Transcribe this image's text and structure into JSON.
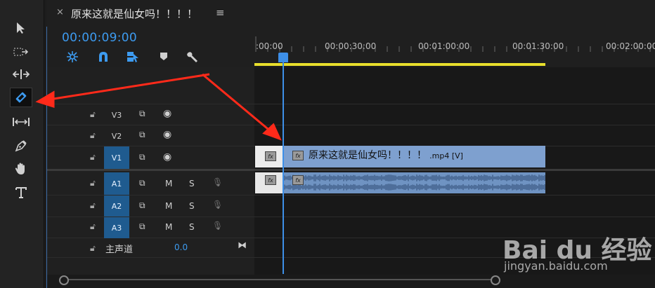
{
  "sequence_tab": {
    "close_label": "×",
    "title": "原来这就是仙女吗！！！！",
    "menu_label": "≡"
  },
  "timecode": "00:00:09:00",
  "toolbar_icons": [
    "snap-nest-icon",
    "snap-magnet-icon",
    "linked-selection-icon",
    "add-marker-icon",
    "wrench-icon"
  ],
  "tools": [
    "selection-tool",
    "track-select-tool",
    "ripple-edit-tool",
    "razor-tool",
    "slip-tool",
    "pen-tool",
    "hand-tool",
    "type-tool"
  ],
  "active_tool": "razor-tool",
  "ruler": {
    "ticks": [
      ":00:00",
      "00:00:30:00",
      "00:01:00:00",
      "00:01:30:00",
      "00:02:00:00"
    ]
  },
  "tracks": {
    "video": [
      {
        "name": "V3",
        "targeted": false
      },
      {
        "name": "V2",
        "targeted": false
      },
      {
        "name": "V1",
        "targeted": true
      }
    ],
    "audio": [
      {
        "name": "A1",
        "targeted": true,
        "mute": "M",
        "solo": "S"
      },
      {
        "name": "A2",
        "targeted": true,
        "mute": "M",
        "solo": "S"
      },
      {
        "name": "A3",
        "targeted": true,
        "mute": "M",
        "solo": "S"
      }
    ],
    "master": {
      "label": "主声道",
      "value": "0.0"
    }
  },
  "clips": {
    "video": {
      "name": "原来这就是仙女吗！！！！",
      "suffix": ".mp4 [V]",
      "fx": "fx"
    },
    "audio": {
      "fx": "fx"
    }
  },
  "watermark": {
    "logo": "Bai du 经验",
    "url": "jingyan.baidu.com"
  },
  "colors": {
    "accent": "#3d9bf0",
    "work_area": "#e8df2c",
    "video_clip": "#7ea0cf",
    "audio_clip": "#6f93c2",
    "annotation_arrow": "#ff2a1a"
  }
}
